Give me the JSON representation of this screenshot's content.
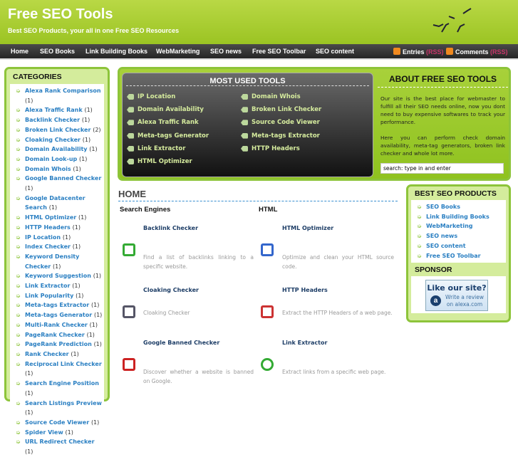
{
  "header": {
    "title": "Free SEO Tools",
    "tagline": "Best SEO Products, your all in one Free SEO Resources"
  },
  "nav": {
    "items": [
      "Home",
      "SEO Books",
      "Link Building Books",
      "WebMarketing",
      "SEO news",
      "Free SEO Toolbar",
      "SEO content"
    ],
    "entries": "Entries",
    "comments": "Comments",
    "rss": "(RSS)"
  },
  "categories": {
    "title": "CATEGORIES",
    "items": [
      {
        "label": "Alexa Rank Comparison",
        "count": "(1)"
      },
      {
        "label": "Alexa Traffic Rank",
        "count": "(1)"
      },
      {
        "label": "Backlink Checker",
        "count": "(1)"
      },
      {
        "label": "Broken Link Checker",
        "count": "(2)"
      },
      {
        "label": "Cloaking Checker",
        "count": "(1)"
      },
      {
        "label": "Domain Availability",
        "count": "(1)"
      },
      {
        "label": "Domain Look-up",
        "count": "(1)"
      },
      {
        "label": "Domain Whois",
        "count": "(1)"
      },
      {
        "label": "Google Banned Checker",
        "count": "(1)"
      },
      {
        "label": "Google Datacenter Search",
        "count": "(1)"
      },
      {
        "label": "HTML Optimizer",
        "count": "(1)"
      },
      {
        "label": "HTTP Headers",
        "count": "(1)"
      },
      {
        "label": "IP Location",
        "count": "(1)"
      },
      {
        "label": "Index Checker",
        "count": "(1)"
      },
      {
        "label": "Keyword Density Checker",
        "count": "(1)"
      },
      {
        "label": "Keyword Suggestion",
        "count": "(1)"
      },
      {
        "label": "Link Extractor",
        "count": "(1)"
      },
      {
        "label": "Link Popularity",
        "count": "(1)"
      },
      {
        "label": "Meta-tags Extractor",
        "count": "(1)"
      },
      {
        "label": "Meta-tags Generator",
        "count": "(1)"
      },
      {
        "label": "Multi-Rank Checker",
        "count": "(1)"
      },
      {
        "label": "PageRank Checker",
        "count": "(1)"
      },
      {
        "label": "PageRank Prediction",
        "count": "(1)"
      },
      {
        "label": "Rank Checker",
        "count": "(1)"
      },
      {
        "label": "Reciprocal Link Checker",
        "count": "(1)"
      },
      {
        "label": "Search Engine Position",
        "count": "(1)"
      },
      {
        "label": "Search Listings Preview",
        "count": "(1)"
      },
      {
        "label": "Source Code Viewer",
        "count": "(1)"
      },
      {
        "label": "Spider View",
        "count": "(1)"
      },
      {
        "label": "URL Redirect Checker",
        "count": "(1)"
      }
    ]
  },
  "tools": {
    "title": "MOST USED TOOLS",
    "left": [
      "IP Location",
      "Domain Availability",
      "Alexa Traffic Rank",
      "Meta-tags Generator",
      "Link Extractor",
      "HTML Optimizer"
    ],
    "right": [
      "Domain Whois",
      "Broken Link Checker",
      "Source Code Viewer",
      "Meta-tags Extractor",
      "HTTP Headers"
    ]
  },
  "about": {
    "title": "ABOUT FREE SEO TOOLS",
    "p1": "Our site is the best place for webmaster to fulfill all their SEO needs online, now you dont need to buy expensive softwares to track your performance.",
    "p2": "Here you can perform check domain availability, meta-tag generators, broken link checker and whole lot more.",
    "search_value": "search: type in and enter"
  },
  "home": {
    "title": "HOME",
    "col1": {
      "heading": "Search Engines",
      "items": [
        {
          "title": "Backlink Checker",
          "desc": "Find a list of backlinks linking to a specific website."
        },
        {
          "title": "Cloaking Checker",
          "desc": "Cloaking Checker"
        },
        {
          "title": "Google Banned Checker",
          "desc": "Discover whether a website is banned on Google."
        }
      ]
    },
    "col2": {
      "heading": "HTML",
      "items": [
        {
          "title": "HTML Optimizer",
          "desc": "Optimize and clean your HTML source code."
        },
        {
          "title": "HTTP Headers",
          "desc": "Extract the HTTP Headers of a web page."
        },
        {
          "title": "Link Extractor",
          "desc": "Extract links from a specific web page."
        }
      ]
    }
  },
  "products": {
    "title": "BEST SEO PRODUCTS",
    "items": [
      "SEO Books",
      "Link Building Books",
      "WebMarketing",
      "SEO news",
      "SEO content",
      "Free SEO Toolbar"
    ]
  },
  "sponsor": {
    "title": "SPONSOR",
    "headline": "Like our site?",
    "sub1": "Write a review",
    "sub2": "on alexa.com"
  },
  "colors": {
    "green": "#8dc43a",
    "link": "#2a7fc2"
  }
}
